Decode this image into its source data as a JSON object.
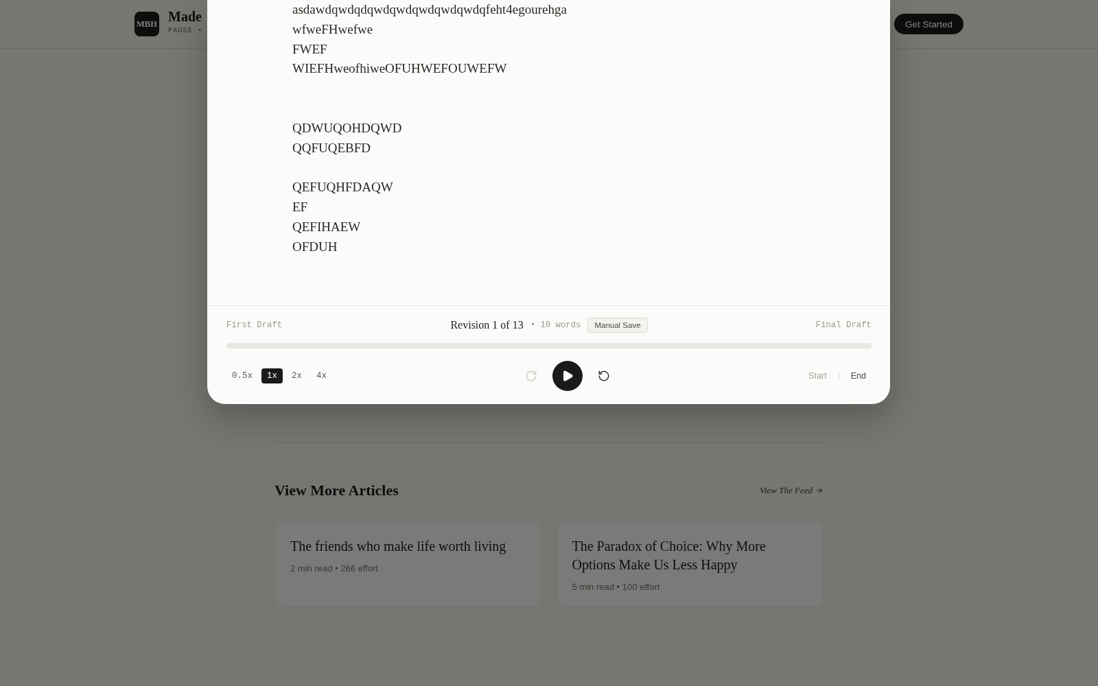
{
  "header": {
    "logo": "MBH",
    "site_name": "Made",
    "tagline": "PAUSE •",
    "cta": "Get Started"
  },
  "modal": {
    "document_text": "asdawdqwdqdqwdqwdqwdqwdqwdqfeht4egourehga\nwfweFHwefwe\nFWEF\nWIEFHweofhiweOFUHWEFOUWEFW\n\n\nQDWUQOHDQWD\nQQFUQEBFD\n\nQEFUQHFDAQW\nEF\nQEFIHAEW\nOFDUH",
    "timeline": {
      "start_label": "First Draft",
      "revision": "Revision 1 of 13",
      "word_count": "• 10 words",
      "save_badge": "Manual Save",
      "end_label": "Final Draft",
      "level": 0
    },
    "speeds": [
      {
        "label": "0.5x",
        "selected": false
      },
      {
        "label": "1x",
        "selected": true
      },
      {
        "label": "2x",
        "selected": false
      },
      {
        "label": "4x",
        "selected": false
      }
    ],
    "playback_buttons": [
      {
        "kind": "redo",
        "disabled": true
      },
      {
        "kind": "play",
        "disabled": false
      },
      {
        "kind": "restart",
        "disabled": false
      }
    ],
    "jump_buttons": [
      {
        "label": "Start",
        "disabled": true
      },
      {
        "label": "End",
        "disabled": false
      }
    ]
  },
  "more_articles": {
    "title": "View More Articles",
    "link": "View The Feed",
    "cards": [
      {
        "title": "The friends who make life worth living",
        "meta": "2 min read • 266 effort"
      },
      {
        "title": "The Paradox of Choice: Why More Options Make Us Less Happy",
        "meta": "5 min read • 100 effort"
      }
    ]
  }
}
